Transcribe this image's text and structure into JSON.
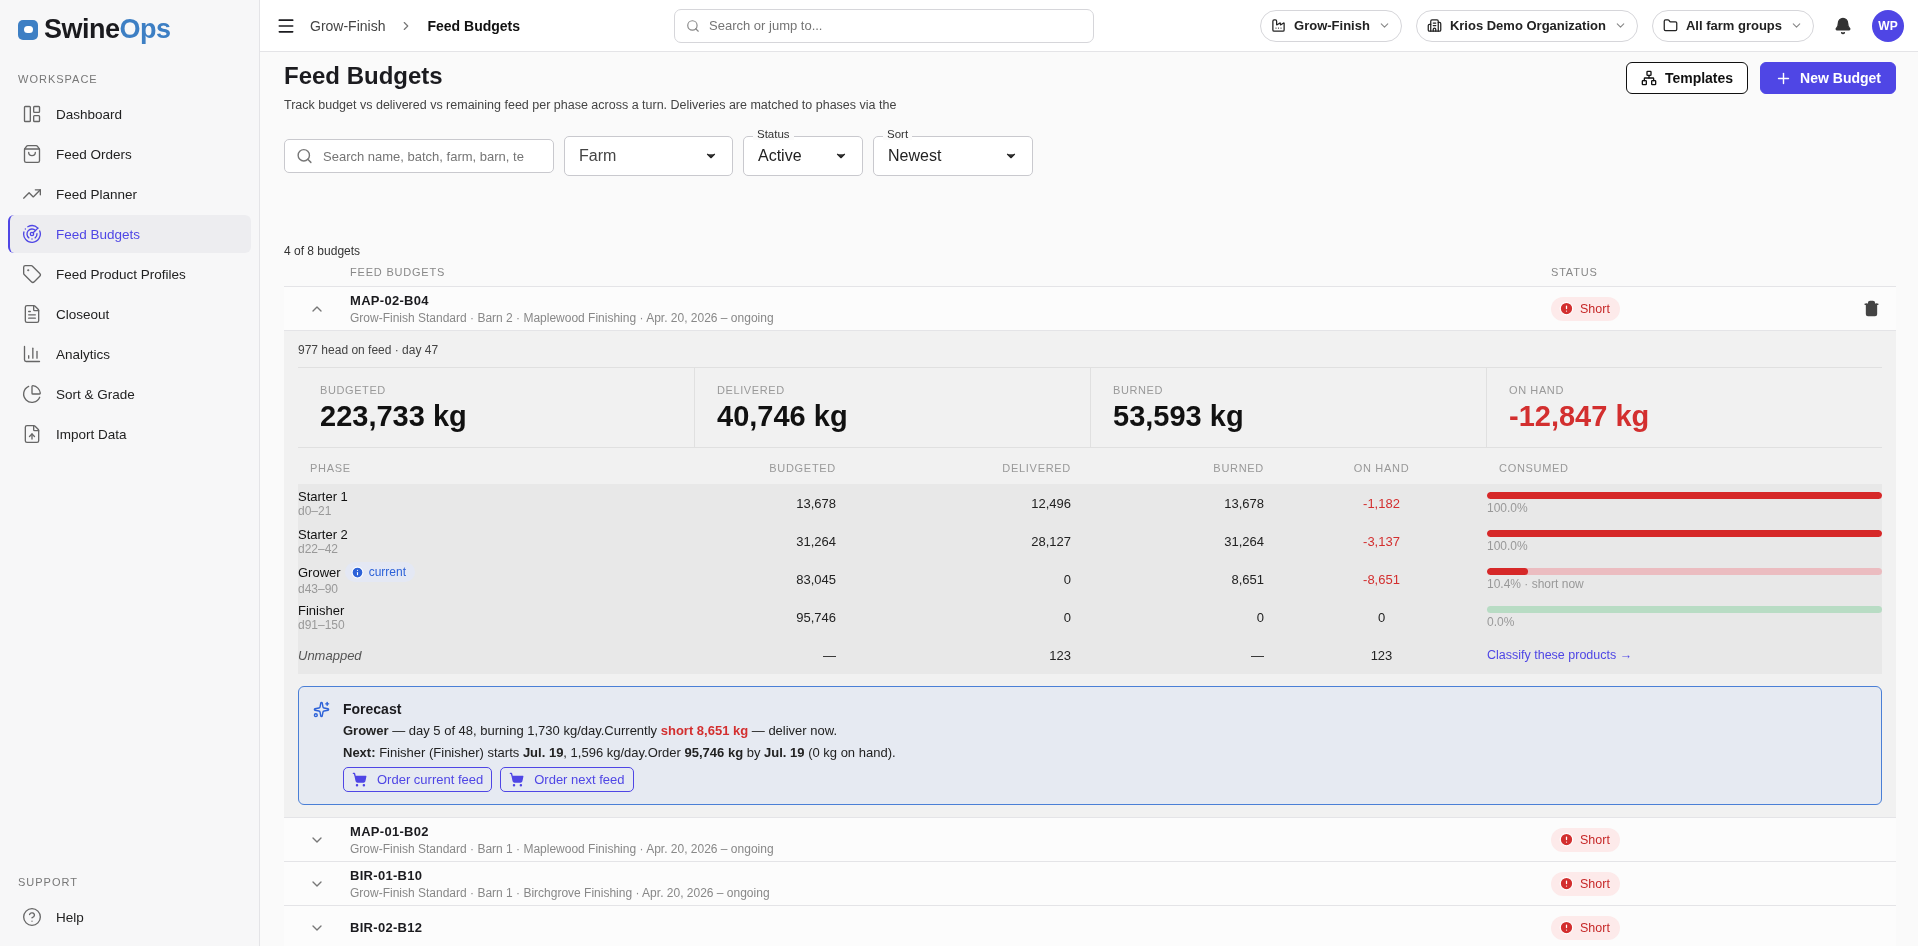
{
  "sidebar": {
    "logo": {
      "first": "Swine",
      "second": "Ops"
    },
    "sections": [
      {
        "title": "WORKSPACE",
        "items": [
          {
            "label": "Dashboard",
            "selected": false
          },
          {
            "label": "Feed Orders",
            "selected": false
          },
          {
            "label": "Feed Planner",
            "selected": false
          },
          {
            "label": "Feed Budgets",
            "selected": true
          },
          {
            "label": "Feed Product Profiles",
            "selected": false
          },
          {
            "label": "Closeout",
            "selected": false
          },
          {
            "label": "Analytics",
            "selected": false
          },
          {
            "label": "Sort & Grade",
            "selected": false
          },
          {
            "label": "Import Data",
            "selected": false
          }
        ]
      },
      {
        "title": "SUPPORT",
        "items": [
          {
            "label": "Help",
            "selected": false
          }
        ]
      }
    ]
  },
  "topbar": {
    "breadcrumb": [
      "Grow-Finish",
      "Feed Budgets"
    ],
    "search": {
      "placeholder": "Search or jump to..."
    },
    "selectors": [
      "Grow-Finish",
      "Krios Demo Organization",
      "All farm groups"
    ],
    "avatar": "WP"
  },
  "page": {
    "title": "Feed Budgets",
    "subtitle": "Track budget vs delivered vs remaining feed per phase across a turn. Deliveries are matched to phases via the",
    "actions": [
      "Templates",
      "New Budget"
    ]
  },
  "filters": {
    "search": {
      "placeholder": "Search name, batch, farm, barn, te"
    },
    "farm": {
      "placeholder": "Farm"
    },
    "status": {
      "label": "Status",
      "value": "Active"
    },
    "sort": {
      "label": "Sort",
      "value": "Newest"
    }
  },
  "count": "4 of 8 budgets",
  "table": {
    "columns": [
      "FEED BUDGETS",
      "STATUS"
    ],
    "rows": [
      {
        "code": "MAP-02-B04",
        "meta": "Grow-Finish Standard · Barn 2 · Maplewood Finishing · Apr. 20, 2026 – ongoing",
        "status": {
          "kind": "short",
          "label": "Short"
        },
        "expanded": true
      },
      {
        "code": "MAP-01-B02",
        "meta": "Grow-Finish Standard · Barn 1 · Maplewood Finishing · Apr. 20, 2026 – ongoing",
        "status": {
          "kind": "short",
          "label": "Short"
        },
        "expanded": false
      },
      {
        "code": "BIR-01-B10",
        "meta": "Grow-Finish Standard · Barn 1 · Birchgrove Finishing · Apr. 20, 2026 – ongoing",
        "status": {
          "kind": "short",
          "label": "Short"
        },
        "expanded": false
      },
      {
        "code": "BIR-02-B12",
        "status": {
          "kind": "short",
          "label": "Short"
        },
        "expanded": false
      }
    ]
  },
  "detail": {
    "head": "977 head on feed · day 47",
    "stats": [
      {
        "label": "BUDGETED",
        "value": "223,733 kg",
        "alert": false
      },
      {
        "label": "DELIVERED",
        "value": "40,746 kg",
        "alert": false
      },
      {
        "label": "BURNED",
        "value": "53,593 kg",
        "alert": false
      },
      {
        "label": "ON HAND",
        "value": "-12,847 kg",
        "alert": true
      }
    ],
    "phase_columns": [
      "PHASE",
      "BUDGETED",
      "DELIVERED",
      "BURNED",
      "ON HAND",
      "CONSUMED"
    ],
    "phases": [
      {
        "kind": "phase",
        "name": "Starter 1",
        "days": "d0–21",
        "budgeted": "13,678",
        "delivered": "12,496",
        "burned": "13,678",
        "on_hand": "-1,182",
        "on_hand_alert": true,
        "level": 1.0,
        "consumed": "100.0%",
        "short": true
      },
      {
        "kind": "phase",
        "name": "Starter 2",
        "days": "d22–42",
        "budgeted": "31,264",
        "delivered": "28,127",
        "burned": "31,264",
        "on_hand": "-3,137",
        "on_hand_alert": true,
        "level": 1.0,
        "consumed": "100.0%",
        "short": true
      },
      {
        "kind": "phase",
        "name": "Grower",
        "days": "d43–90",
        "badge": "current",
        "budgeted": "83,045",
        "delivered": "0",
        "burned": "8,651",
        "on_hand": "-8,651",
        "on_hand_alert": true,
        "level": 0.104,
        "consumed": "10.4% · short now",
        "short": true
      },
      {
        "kind": "phase",
        "name": "Finisher",
        "days": "d91–150",
        "budgeted": "95,746",
        "delivered": "0",
        "burned": "0",
        "on_hand": "0",
        "on_hand_alert": false,
        "level": 0.0,
        "consumed": "0.0%",
        "short": false
      },
      {
        "kind": "unmapped",
        "name": "Unmapped",
        "budgeted": "—",
        "delivered": "123",
        "burned": "—",
        "on_hand": "123",
        "link": "Classify these products →"
      }
    ],
    "forecast": {
      "title": "Forecast",
      "lines": [
        {
          "lead": "Grower",
          "before": " — day 5 of 48, burning 1,730 kg/day.Currently ",
          "alert": "short 8,651 kg",
          "after": " — deliver now."
        },
        {
          "lead": "Next:",
          "before": " Finisher (Finisher) starts **Jul. 19**, 1,596 kg/day.Order **95,746 kg** by **Jul. 19** (0 kg on hand)."
        }
      ],
      "buttons": [
        "Order current feed",
        "Order next feed"
      ]
    }
  }
}
